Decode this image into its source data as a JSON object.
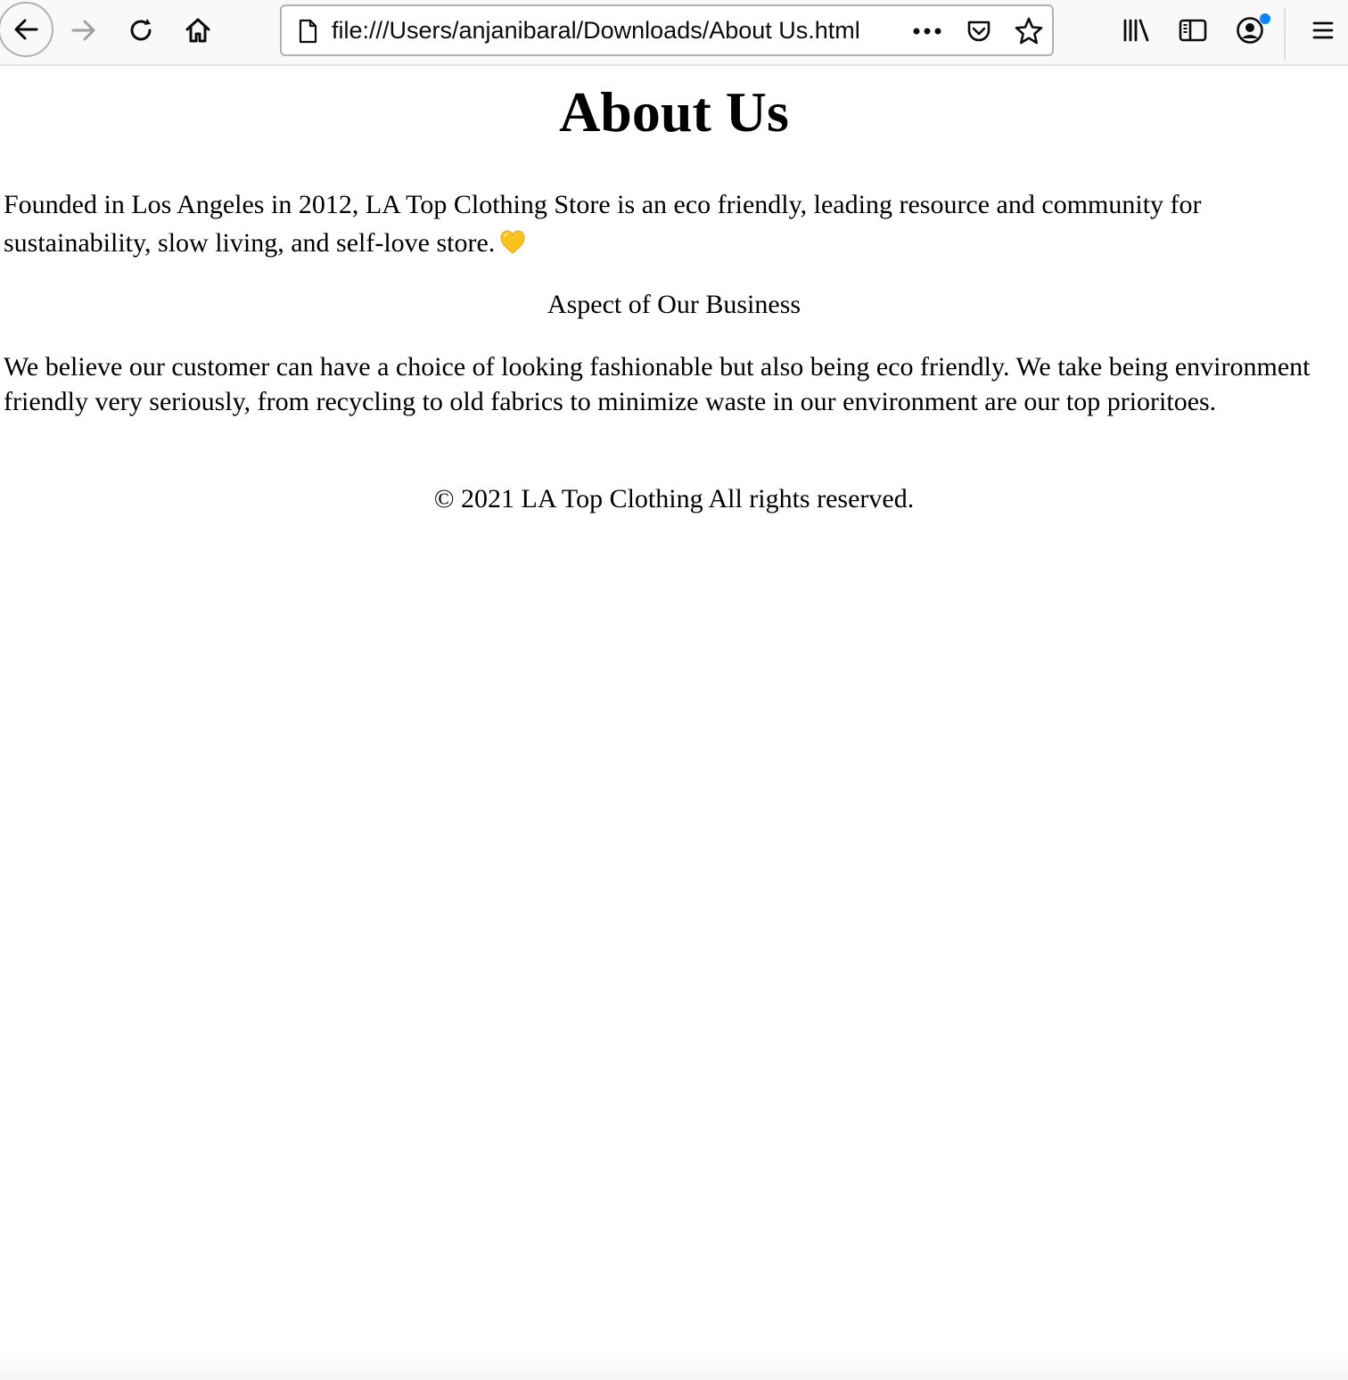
{
  "browser": {
    "url": "file:///Users/anjanibaral/Downloads/About Us.html",
    "accent_color": "#0a84ff"
  },
  "page": {
    "title": "About Us",
    "intro": "Founded in Los Angeles in 2012, LA Top Clothing Store is an eco friendly, leading resource and community for sustainability, slow living, and self-love store.",
    "intro_icon": "yellow-heart-icon",
    "section_heading": "Aspect of Our Business",
    "body": "We believe our customer can have a choice of looking fashionable but also being eco friendly. We take being environment friendly very seriously, from recycling to old fabrics to minimize waste in our environment are our top prioritoes.",
    "footer": "© 2021 LA Top Clothing All rights reserved."
  }
}
